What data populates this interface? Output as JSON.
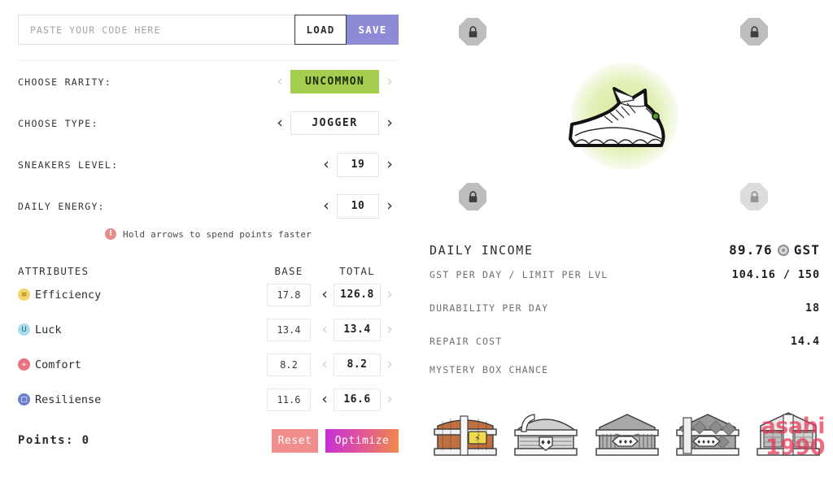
{
  "code_bar": {
    "placeholder": "PASTE YOUR CODE HERE",
    "value": "",
    "load_label": "LOAD",
    "save_label": "SAVE",
    "save_color": "#8d8ad6"
  },
  "selectors": [
    {
      "label": "CHOOSE RARITY:",
      "value": "UNCOMMON",
      "kind": "rarity",
      "highlight_color": "#a5ce4e",
      "left_active": false,
      "right_active": false
    },
    {
      "label": "CHOOSE TYPE:",
      "value": "JOGGER",
      "kind": "type",
      "left_active": true,
      "right_active": true
    },
    {
      "label": "SNEAKERS LEVEL:",
      "value": "19",
      "kind": "num",
      "left_active": true,
      "right_active": true
    },
    {
      "label": "DAILY ENERGY:",
      "value": "10",
      "kind": "num",
      "left_active": true,
      "right_active": true
    }
  ],
  "hint": {
    "icon": "exclamation-icon",
    "glyph": "!",
    "text": "Hold arrows to spend points faster"
  },
  "attributes_header": {
    "name": "ATTRIBUTES",
    "base": "BASE",
    "total": "TOTAL"
  },
  "attributes": [
    {
      "name": "Efficiency",
      "icon": "efficiency-icon",
      "icon_color": "#f5d46b",
      "glyph": "≡",
      "base": "17.8",
      "total": "126.8",
      "left_active": true,
      "right_active": false
    },
    {
      "name": "Luck",
      "icon": "luck-icon",
      "icon_color": "#a8dcec",
      "glyph": "U",
      "base": "13.4",
      "total": "13.4",
      "left_active": false,
      "right_active": false
    },
    {
      "name": "Comfort",
      "icon": "comfort-icon",
      "icon_color": "#e8727f",
      "glyph": "+",
      "base": "8.2",
      "total": "8.2",
      "left_active": false,
      "right_active": false
    },
    {
      "name": "Resiliense",
      "icon": "resiliense-icon",
      "icon_color": "#6d7fd0",
      "glyph": "□",
      "base": "11.6",
      "total": "16.6",
      "left_active": true,
      "right_active": false
    }
  ],
  "footer": {
    "points_label": "Points: 0",
    "reset_label": "Reset",
    "optimize_label": "Optimize",
    "reset_color": "#f08d8d",
    "optimize_gradient_from": "#c32fd6",
    "optimize_gradient_to": "#ef8a4a"
  },
  "sneaker": {
    "name": "sneaker-preview",
    "glow_color": "#d4e89a",
    "sockets": [
      {
        "position": "top-left",
        "state": "locked"
      },
      {
        "position": "top-right",
        "state": "locked"
      },
      {
        "position": "bottom-left",
        "state": "locked"
      },
      {
        "position": "bottom-right",
        "state": "locked-faded"
      }
    ]
  },
  "income": {
    "title": "DAILY INCOME",
    "amount": "89.76",
    "currency": "GST",
    "coin_icon": "gst-coin-icon",
    "stats": [
      {
        "label": "GST PER DAY / LIMIT PER LVL",
        "value": "104.16 / 150"
      },
      {
        "label": "DURABILITY PER DAY",
        "value": "18"
      },
      {
        "label": "REPAIR COST",
        "value": "14.4"
      }
    ],
    "mystery_label": "MYSTERY BOX CHANCE",
    "chests": [
      {
        "tier": 1,
        "style": "wooden-gold",
        "body": "#c1713f",
        "accent": "#f2d94e",
        "marks": "⚡"
      },
      {
        "tier": 2,
        "style": "grey-1",
        "body": "#c9c9c9",
        "accent": "#ffffff",
        "marks": "♦♦"
      },
      {
        "tier": 3,
        "style": "grey-2",
        "body": "#a8a8a8",
        "accent": "#ffffff",
        "marks": "♦♦♦"
      },
      {
        "tier": 4,
        "style": "grey-3",
        "body": "#9a9a9a",
        "accent": "#ffffff",
        "marks": "♦♦♦♦"
      },
      {
        "tier": 5,
        "style": "grey-4",
        "body": "#bdbdbd",
        "accent": "#ffffff",
        "marks": ""
      }
    ]
  },
  "watermark": {
    "line1": "asahi",
    "line2": "1990",
    "color": "#e43454"
  }
}
